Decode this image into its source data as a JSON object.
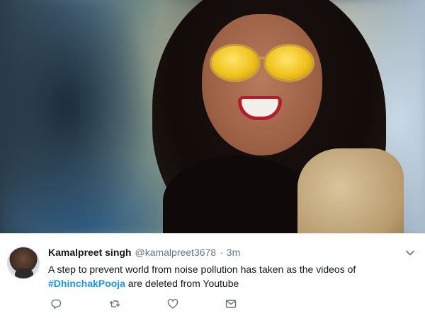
{
  "tweet": {
    "display_name": "Kamalpreet singh",
    "handle": "@kamalpreet3678",
    "separator": "·",
    "time": "3m",
    "text_before": "A step to prevent world from noise pollution has taken as the videos of ",
    "hashtag": "#DhinchakPooja",
    "text_after": " are deleted from Youtube",
    "actions": [
      "reply-icon",
      "retweet-icon",
      "like-icon",
      "message-icon"
    ],
    "menu_icon": "chevron-down-icon"
  },
  "colors": {
    "hashtag": "#1b95e0",
    "muted": "#657786",
    "icon": "#657786"
  }
}
